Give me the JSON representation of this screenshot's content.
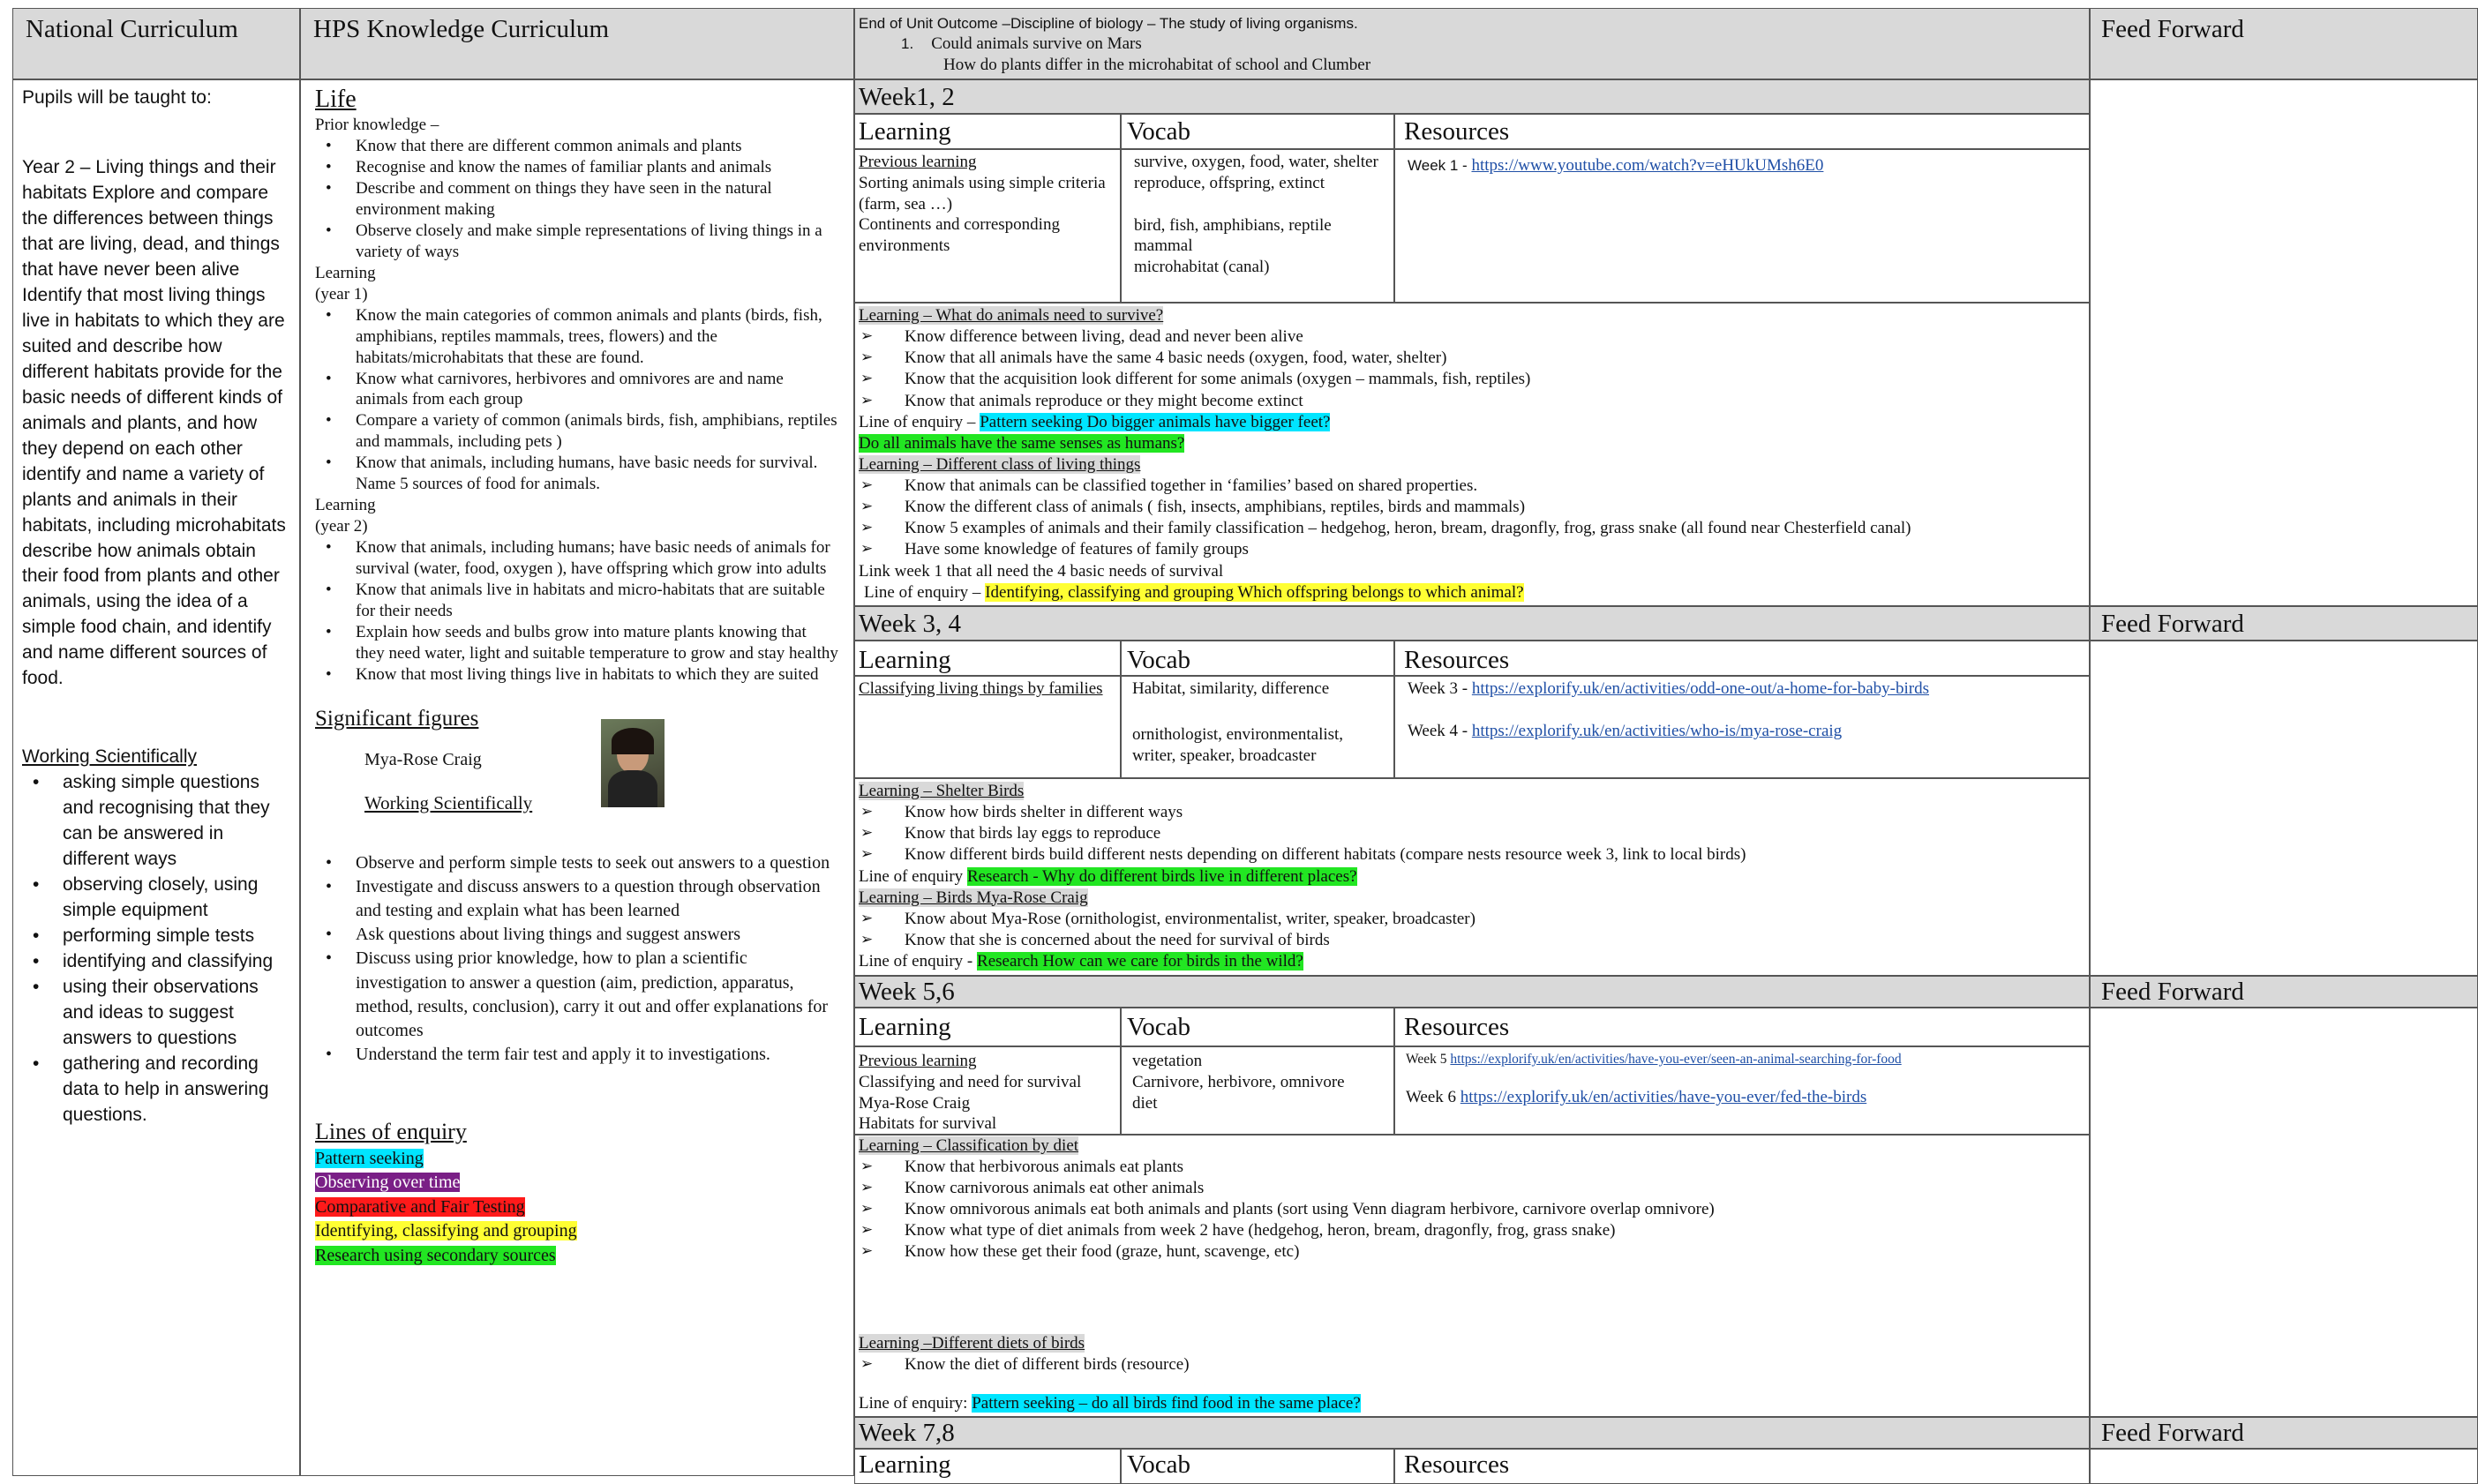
{
  "headers": {
    "nc": "National Curriculum",
    "hps": "HPS Knowledge Curriculum",
    "eou_line1": "End of Unit Outcome –Discipline of biology – The study of living organisms.",
    "eou_num": "1.",
    "eou_q1": "Could animals survive on Mars",
    "eou_q2": "How do plants differ in the microhabitat of school and Clumber",
    "ff": "Feed Forward"
  },
  "national": {
    "intro": "Pupils will be taught to:",
    "p1": "Year 2 – Living things and their habitats Explore and compare the differences between things that are living, dead, and things that have never been alive Identify that most living things live in habitats to which they are suited and describe how different habitats provide for the basic needs of different kinds of animals and plants, and how they depend on each other identify and name a variety of plants and animals in their habitats, including microhabitats describe how animals obtain their food from plants and other animals, using the idea of a simple food chain, and identify and name different sources of food.",
    "ws_title": "Working Scientifically",
    "ws": [
      "asking simple questions and recognising that they can be answered in different ways",
      "observing closely, using simple equipment",
      "performing simple tests",
      "identifying and classifying",
      "using their observations and ideas to suggest answers to questions",
      "gathering and recording data to help in answering questions."
    ]
  },
  "hps": {
    "title": "Life",
    "prior_label": "Prior knowledge –",
    "prior": [
      "Know that there are different common animals and plants",
      "Recognise and know the names of familiar plants and animals",
      "Describe and comment on things they have seen in the natural environment making",
      "Observe closely and make simple representations of living things in a variety of ways"
    ],
    "learning_label": "Learning",
    "year1": "(year 1)",
    "y1": [
      "Know the main categories of common animals and plants (birds, fish, amphibians, reptiles mammals, trees, flowers) and the habitats/microhabitats that these are found.",
      "Know what carnivores, herbivores and omnivores are and name animals from each group",
      "Compare a variety of common (animals birds, fish, amphibians, reptiles and mammals, including pets )",
      "Know that animals, including humans, have basic needs for survival. Name 5 sources of food for animals."
    ],
    "year2": "(year 2)",
    "y2": [
      "Know that animals, including humans; have basic needs of animals for survival (water, food, oxygen ), have offspring which grow into adults",
      "Know that animals live in habitats and micro-habitats that are suitable for their needs",
      "Explain how seeds and bulbs grow into mature plants knowing that they need water, light and suitable temperature to grow and stay healthy",
      "Know that most living things live in habitats to which they are suited"
    ],
    "sig_title": "Significant figures",
    "sig_name": "Mya-Rose Craig",
    "ws_title": "Working Scientifically",
    "ws": [
      "Observe and perform simple tests to seek out answers to a question",
      "Investigate and discuss answers to a question through observation and testing and explain what has been learned",
      "Ask questions about living things and suggest answers",
      "Discuss using prior knowledge, how to plan a scientific investigation to answer a question (aim, prediction, apparatus, method, results, conclusion), carry it out and offer explanations for outcomes",
      "Understand the term fair test and apply it to investigations."
    ],
    "loe_title": "Lines of enquiry",
    "loe": [
      "Pattern seeking",
      "Observing over time",
      "Comparative and Fair Testing",
      "Identifying, classifying and grouping",
      "Research using secondary sources"
    ],
    "colors": [
      "#00e5ff",
      "#7a1f86",
      "#ff1a1a",
      "#ffff33",
      "#22e622"
    ]
  },
  "cols": {
    "learning": "Learning",
    "vocab": "Vocab",
    "resources": "Resources"
  },
  "w12": {
    "title": "Week1, 2",
    "learn": [
      "Previous learning",
      "Sorting animals using simple criteria (farm, sea …)",
      "Continents and corresponding environments"
    ],
    "vocab": [
      "survive, oxygen, food, water, shelter",
      "reproduce, offspring, extinct",
      "",
      "bird, fish, amphibians, reptile",
      "mammal",
      "microhabitat (canal)"
    ],
    "res_label": "Week 1 -",
    "res_link": "https://www.youtube.com/watch?v=eHUkUMsh6E0",
    "h1": "Learning – What do animals need to survive?",
    "b1": [
      "Know difference between living, dead and never been alive",
      "Know that all animals  have the same 4 basic needs (oxygen, food, water, shelter)",
      "Know that the acquisition look different for some animals (oxygen – mammals, fish, reptiles)",
      "Know that animals reproduce or they might become extinct"
    ],
    "loe1_label": "Line of enquiry –",
    "loe1": "Pattern seeking Do bigger animals have bigger feet?",
    "loe1b": "Do all animals have the same senses as humans?",
    "h2": "Learning – Different class of living things",
    "b2": [
      "Know that animals can be classified together in ‘families’ based on shared properties.",
      "Know the different class of animals ( fish, insects, amphibians, reptiles, birds and mammals)",
      "Know 5 examples of animals and their family classification – hedgehog, heron, bream, dragonfly, frog, grass snake (all found near Chesterfield canal)",
      "Have some knowledge of features of family groups"
    ],
    "link": "Link week 1 that all need the 4 basic needs of survival",
    "loe2_label": "Line of enquiry –",
    "loe2": "Identifying, classifying and grouping Which offspring belongs to which animal?"
  },
  "w34": {
    "title": "Week 3, 4",
    "learn": "Classifying living things by families",
    "vocab1": "Habitat, similarity, difference",
    "vocab2": "ornithologist, environmentalist, writer, speaker, broadcaster",
    "r3_label": "Week 3 -",
    "r3": "https://explorify.uk/en/activities/odd-one-out/a-home-for-baby-birds",
    "r4_label": "Week 4 -",
    "r4": "https://explorify.uk/en/activities/who-is/mya-rose-craig",
    "h1": "Learning – Shelter  Birds",
    "b1": [
      "Know how birds shelter in different ways",
      "Know that birds lay eggs to reproduce",
      "Know different birds build different nests depending on different habitats (compare nests resource week 3, link to local birds)"
    ],
    "loe1_label": "Line of enquiry",
    "loe1": "Research - Why do different birds live in different places?",
    "h2": "Learning – Birds Mya-Rose Craig",
    "b2": [
      "Know about Mya-Rose (ornithologist, environmentalist, writer, speaker, broadcaster)",
      "Know that she is concerned about the need for survival of birds"
    ],
    "loe2_label": "Line of enquiry  -",
    "loe2": "Research How can we care for birds in the wild?"
  },
  "w56": {
    "title": "Week 5,6",
    "learn": [
      "Previous learning",
      "Classifying and need for survival",
      "Mya-Rose Craig",
      "Habitats for survival"
    ],
    "vocab": [
      "vegetation",
      "Carnivore, herbivore, omnivore",
      "diet"
    ],
    "r5_label": "Week 5",
    "r5": "https://explorify.uk/en/activities/have-you-ever/seen-an-animal-searching-for-food",
    "r6_label": "Week 6",
    "r6": "https://explorify.uk/en/activities/have-you-ever/fed-the-birds",
    "h1": "Learning – Classification by diet",
    "b1": [
      "Know that herbivorous animals eat plants",
      "Know carnivorous animals eat other animals",
      "Know omnivorous animals eat both animals and plants    (sort using Venn diagram herbivore, carnivore overlap omnivore)",
      "Know what type of diet animals from week 2 have (hedgehog, heron, bream, dragonfly, frog, grass snake)",
      "Know how these get their food (graze, hunt, scavenge, etc)"
    ],
    "h2": "Learning –Different diets of birds",
    "b2": [
      "Know the diet of different birds (resource)"
    ],
    "loe_label": "Line of enquiry:",
    "loe": "Pattern seeking – do all birds find food in the same place?"
  },
  "w78": {
    "title": "Week 7,8"
  }
}
